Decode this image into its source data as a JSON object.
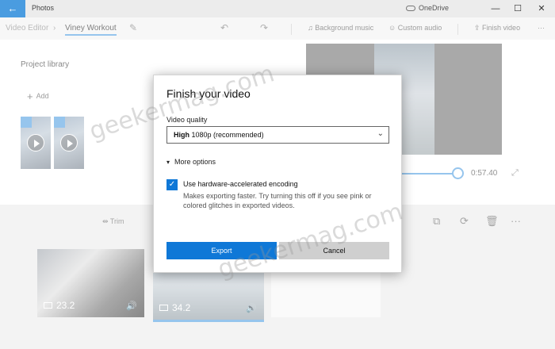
{
  "titlebar": {
    "back_icon": "arrow-left-icon",
    "app_name": "Photos",
    "cloud_icon": "cloud-icon",
    "onedrive": "OneDrive",
    "minimize": "—",
    "maximize": "☐",
    "close": "✕"
  },
  "toolbar": {
    "crumb_root": "Video Editor",
    "crumb_sep": "›",
    "project_name": "Viney Workout",
    "rename_icon": "pencil-icon",
    "undo_icon": "undo-icon",
    "redo_icon": "redo-icon",
    "background_music": "Background music",
    "custom_audio": "Custom audio",
    "finish_video": "Finish video",
    "more": "···"
  },
  "library": {
    "title": "Project library",
    "add_label": "Add",
    "collapse_icon": "chevron-left-icon"
  },
  "preview": {
    "duration": "0:57.40",
    "fullscreen_icon": "expand-icon"
  },
  "storyboard": {
    "trim": "Trim",
    "tools_icons": [
      "crop-icon",
      "rotate-icon",
      "trash-icon"
    ],
    "more": "···",
    "clips": [
      {
        "duration": "23.2"
      },
      {
        "duration": "34.2"
      }
    ]
  },
  "dialog": {
    "title": "Finish your video",
    "quality_label": "Video quality",
    "quality_main": "High",
    "quality_detail": "1080p (recommended)",
    "more_options": "More options",
    "hw_checked": true,
    "hw_label": "Use hardware-accelerated encoding",
    "hw_desc": "Makes exporting faster. Try turning this off if you see pink or colored glitches in exported videos.",
    "export": "Export",
    "cancel": "Cancel"
  },
  "watermark": "geekermag.com",
  "colors": {
    "accent": "#0f78d7",
    "back_button": "#4a9ce0",
    "cancel_bg": "#cfcfcf"
  }
}
